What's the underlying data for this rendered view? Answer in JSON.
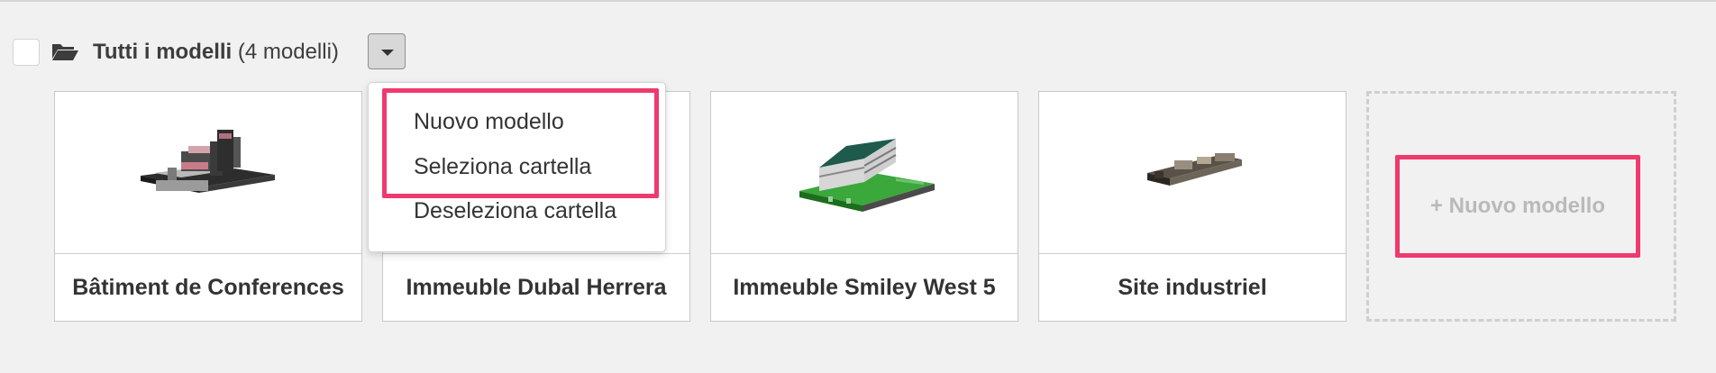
{
  "header": {
    "title_bold": "Tutti i modelli",
    "title_count": "(4 modelli)",
    "folder_icon": "folder-open-icon",
    "dropdown_icon": "caret-down-icon"
  },
  "dropdown_menu": {
    "items": [
      {
        "label": "Nuovo modello"
      },
      {
        "label": "Seleziona cartella"
      },
      {
        "label": "Deseleziona cartella"
      }
    ]
  },
  "models": [
    {
      "name": "Bâtiment de Conferences"
    },
    {
      "name": "Immeuble Dubal Herrera"
    },
    {
      "name": "Immeuble Smiley West 5"
    },
    {
      "name": "Site industriel"
    }
  ],
  "new_model": {
    "label": "+ Nuovo modello"
  },
  "colors": {
    "highlight": "#ee3a6d",
    "background": "#f1f1f1",
    "placeholder_text": "#b9b9b9"
  }
}
